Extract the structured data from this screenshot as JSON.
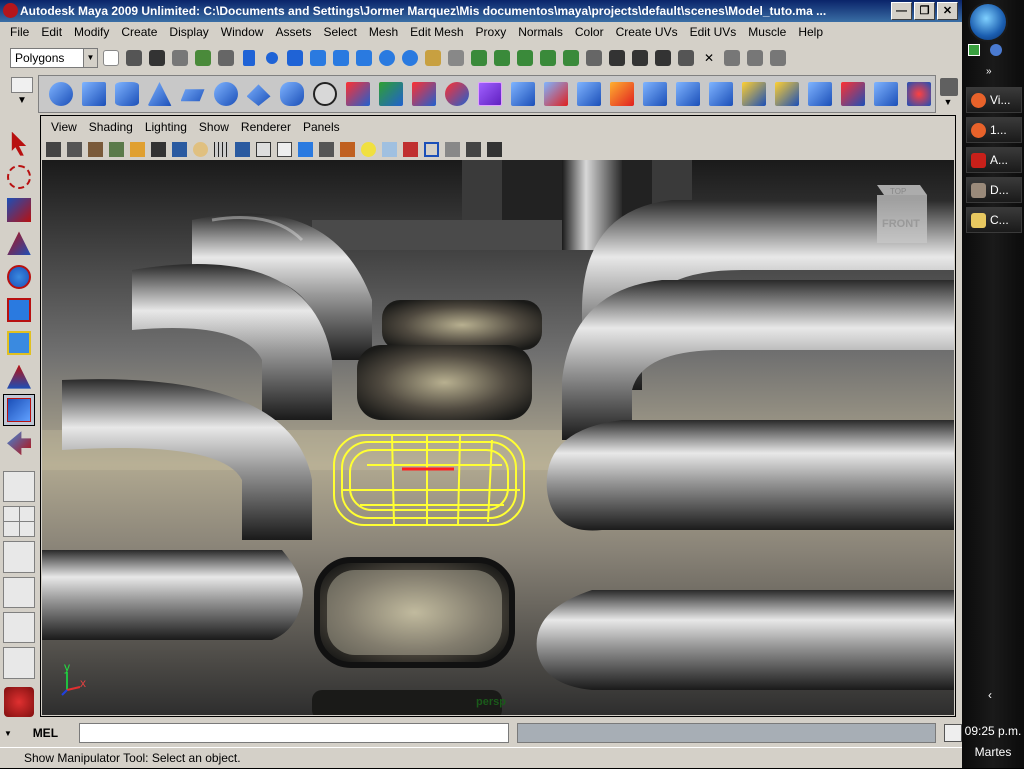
{
  "window": {
    "title": "Autodesk Maya 2009 Unlimited: C:\\Documents and Settings\\Jormer Marquez\\Mis documentos\\maya\\projects\\default\\scenes\\Model_tuto.ma ..."
  },
  "menubar": {
    "items": [
      "File",
      "Edit",
      "Modify",
      "Create",
      "Display",
      "Window",
      "Assets",
      "Select",
      "Mesh",
      "Edit Mesh",
      "Proxy",
      "Normals",
      "Color",
      "Create UVs",
      "Edit UVs",
      "Muscle",
      "Help"
    ]
  },
  "status_line": {
    "mode_value": "Polygons"
  },
  "panel": {
    "menu": [
      "View",
      "Shading",
      "Lighting",
      "Show",
      "Renderer",
      "Panels"
    ],
    "camera_label": "persp",
    "viewcube_top": "TOP",
    "viewcube_front": "FRONT",
    "axis_y": "y",
    "axis_x": "x"
  },
  "command_line": {
    "label": "MEL",
    "value": ""
  },
  "help_line": {
    "text": "Show Manipulator Tool: Select an object."
  },
  "taskbar": {
    "items": [
      {
        "label": "Vi...",
        "icon": "firefox-icon",
        "color": "#e8622a"
      },
      {
        "label": "1...",
        "icon": "firefox-icon",
        "color": "#e8622a"
      },
      {
        "label": "A...",
        "icon": "acrobat-icon",
        "color": "#c8201a"
      },
      {
        "label": "D...",
        "icon": "avatar-icon",
        "color": "#9a8a7a"
      },
      {
        "label": "C...",
        "icon": "folder-icon",
        "color": "#e8c860"
      }
    ],
    "time": "09:25 p.m.",
    "day": "Martes"
  },
  "colors": {
    "selection": "#ffff33",
    "selected_edge": "#ff2020",
    "maya_blue": "#1f63d6"
  }
}
